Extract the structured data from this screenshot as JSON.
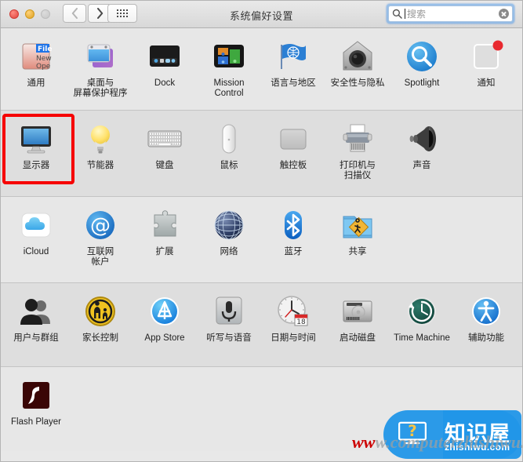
{
  "window": {
    "title": "系统偏好设置",
    "traffic_lights": [
      "close",
      "minimize",
      "zoom"
    ]
  },
  "toolbar": {
    "back_label": "‹",
    "forward_label": "›",
    "grid_label": "显示全部",
    "search": {
      "placeholder": "搜索",
      "value": "",
      "icon": "search-icon",
      "clear_icon": "clear-icon"
    }
  },
  "highlight": {
    "target": "显示器",
    "color": "#f60000"
  },
  "rows": [
    {
      "shade": "a",
      "items": [
        {
          "label": "通用",
          "icon": "general-icon"
        },
        {
          "label": "桌面与\n屏幕保护程序",
          "icon": "desktop-screensaver-icon"
        },
        {
          "label": "Dock",
          "icon": "dock-icon"
        },
        {
          "label": "Mission\nControl",
          "icon": "mission-control-icon"
        },
        {
          "label": "语言与地区",
          "icon": "language-region-icon"
        },
        {
          "label": "安全性与隐私",
          "icon": "security-privacy-icon"
        },
        {
          "label": "Spotlight",
          "icon": "spotlight-icon"
        },
        {
          "label": "通知",
          "icon": "notifications-icon"
        }
      ]
    },
    {
      "shade": "b",
      "items": [
        {
          "label": "显示器",
          "icon": "displays-icon",
          "highlighted": true
        },
        {
          "label": "节能器",
          "icon": "energy-saver-icon"
        },
        {
          "label": "键盘",
          "icon": "keyboard-icon"
        },
        {
          "label": "鼠标",
          "icon": "mouse-icon"
        },
        {
          "label": "触控板",
          "icon": "trackpad-icon"
        },
        {
          "label": "打印机与\n扫描仪",
          "icon": "printers-scanners-icon"
        },
        {
          "label": "声音",
          "icon": "sound-icon"
        }
      ]
    },
    {
      "shade": "a",
      "items": [
        {
          "label": "iCloud",
          "icon": "icloud-icon"
        },
        {
          "label": "互联网\n帐户",
          "icon": "internet-accounts-icon"
        },
        {
          "label": "扩展",
          "icon": "extensions-icon"
        },
        {
          "label": "网络",
          "icon": "network-icon"
        },
        {
          "label": "蓝牙",
          "icon": "bluetooth-icon"
        },
        {
          "label": "共享",
          "icon": "sharing-icon"
        }
      ]
    },
    {
      "shade": "b",
      "items": [
        {
          "label": "用户与群组",
          "icon": "users-groups-icon"
        },
        {
          "label": "家长控制",
          "icon": "parental-controls-icon"
        },
        {
          "label": "App Store",
          "icon": "app-store-icon"
        },
        {
          "label": "听写与语音",
          "icon": "dictation-speech-icon"
        },
        {
          "label": "日期与时间",
          "icon": "date-time-icon"
        },
        {
          "label": "启动磁盘",
          "icon": "startup-disk-icon"
        },
        {
          "label": "Time Machine",
          "icon": "time-machine-icon"
        },
        {
          "label": "辅助功能",
          "icon": "accessibility-icon"
        }
      ]
    },
    {
      "shade": "a",
      "items": [
        {
          "label": "Flash Player",
          "icon": "flash-player-icon"
        }
      ]
    }
  ],
  "watermark": {
    "url_red": "ww",
    "url_gray": "w.computerzhishiwu.com",
    "badge_cn": "知识屋",
    "badge_domain": "zhishiwu.com",
    "badge_color": "#2196e8"
  }
}
